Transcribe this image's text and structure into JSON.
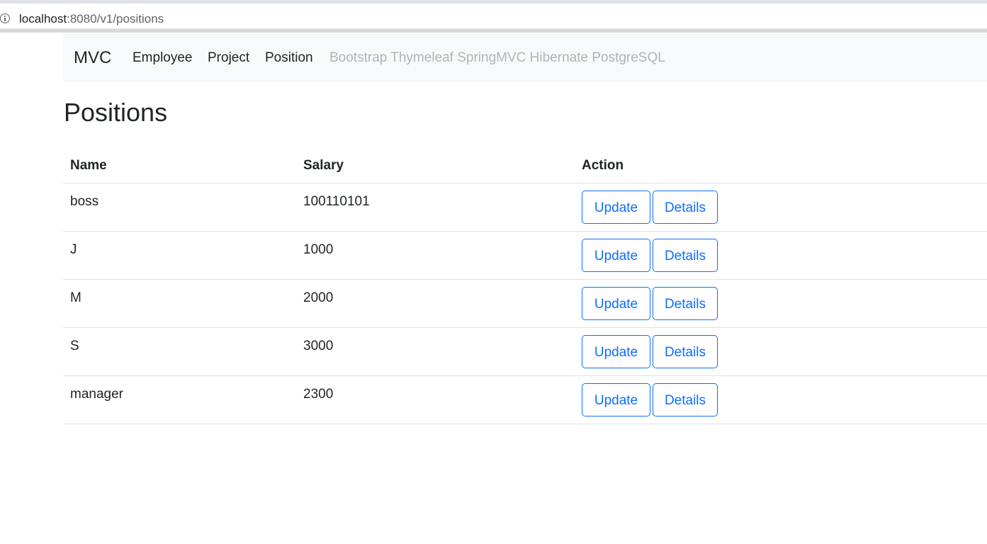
{
  "browser": {
    "url_host": "localhost",
    "url_path": ":8080/v1/positions"
  },
  "navbar": {
    "brand": "MVC",
    "links": [
      "Employee",
      "Project",
      "Position"
    ],
    "tagline": "Bootstrap Thymeleaf SpringMVC Hibernate PostgreSQL"
  },
  "page": {
    "title": "Positions"
  },
  "table": {
    "headers": [
      "Name",
      "Salary",
      "Action"
    ],
    "update_label": "Update",
    "details_label": "Details",
    "rows": [
      {
        "name": "boss",
        "salary": "100110101"
      },
      {
        "name": "J",
        "salary": "1000"
      },
      {
        "name": "M",
        "salary": "2000"
      },
      {
        "name": "S",
        "salary": "3000"
      },
      {
        "name": "manager",
        "salary": "2300"
      }
    ]
  },
  "colors": {
    "primary": "#0d6efd",
    "navbar_bg": "#f8f9fa",
    "muted": "#adb5bd",
    "border": "#dee2e6"
  }
}
